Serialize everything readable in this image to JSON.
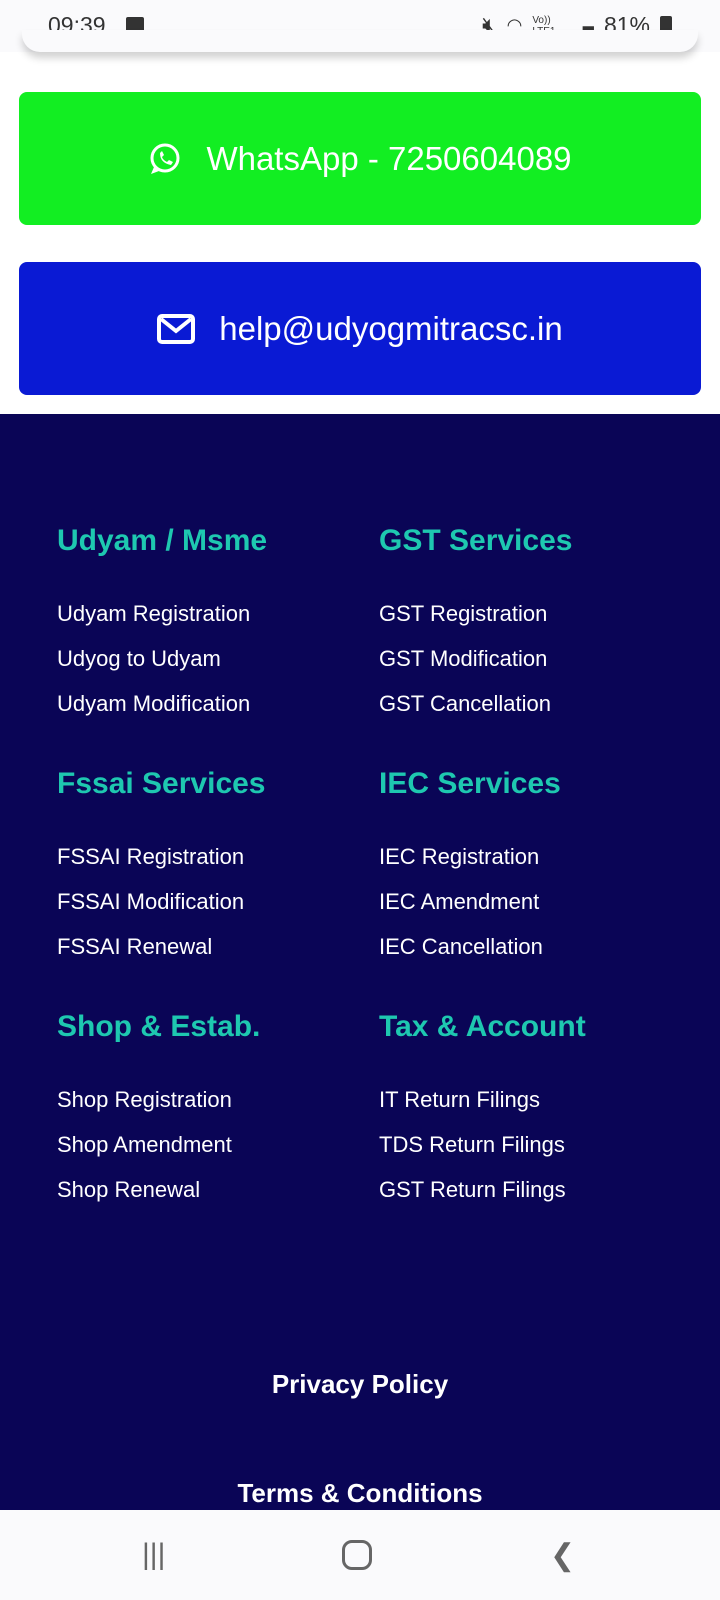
{
  "status_bar": {
    "time": "09:39",
    "signal": "Vo)) LTE1",
    "battery": "81%"
  },
  "contact": {
    "whatsapp_label": "WhatsApp - 7250604089",
    "email_label": "help@udyogmitracsc.in",
    "whatsapp_color": "#12ee22",
    "email_color": "#0a1ad4"
  },
  "footer": {
    "sections": [
      {
        "title": "Udyam / Msme",
        "links": [
          "Udyam Registration",
          "Udyog to Udyam",
          "Udyam Modification"
        ]
      },
      {
        "title": "GST Services",
        "links": [
          "GST Registration",
          "GST Modification",
          "GST Cancellation"
        ]
      },
      {
        "title": "Fssai Services",
        "links": [
          "FSSAI Registration",
          "FSSAI Modification",
          "FSSAI Renewal"
        ]
      },
      {
        "title": "IEC Services",
        "links": [
          "IEC Registration",
          "IEC Amendment",
          "IEC Cancellation"
        ]
      },
      {
        "title": "Shop & Estab.",
        "links": [
          "Shop Registration",
          "Shop Amendment",
          "Shop Renewal"
        ]
      },
      {
        "title": "Tax & Account",
        "links": [
          "IT Return Filings",
          "TDS Return Filings",
          "GST Return Filings"
        ]
      }
    ],
    "privacy": "Privacy Policy",
    "terms": "Terms & Conditions",
    "background": "#0a0556",
    "heading_color": "#1ec8b0"
  },
  "nav": {
    "recent": "recent-apps-icon",
    "home": "home-icon",
    "back": "back-icon"
  }
}
